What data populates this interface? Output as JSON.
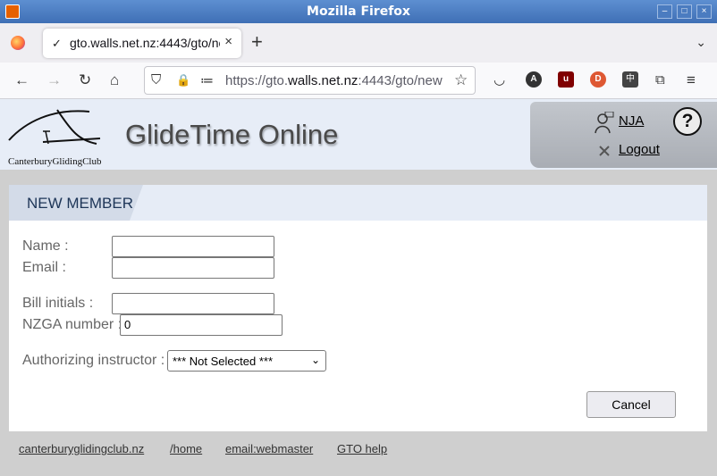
{
  "window": {
    "title": "Mozilla Firefox",
    "min_glyph": "–",
    "max_glyph": "□",
    "close_glyph": "×"
  },
  "tab": {
    "favicon_glyph": "✓",
    "label": "gto.walls.net.nz:4443/gto/new",
    "close_glyph": "×",
    "newtab_glyph": "+",
    "list_glyph": "⌄"
  },
  "nav": {
    "back_glyph": "←",
    "forward_glyph": "→",
    "reload_glyph": "↻",
    "home_glyph": "⌂",
    "url_prefix": "https://gto.",
    "url_host": "walls.net.nz",
    "url_rest": ":4443/gto/new",
    "bookmark_glyph": "☆",
    "shield_glyph": "⛉",
    "lock_glyph": "🔒",
    "perm_glyph": "≔",
    "pocket_glyph": "◡",
    "ext_a_label": "A",
    "ext_ublock_label": "u",
    "ext_ddg_label": "D",
    "ext_zh_label": "中",
    "ext_puzzle_glyph": "⧉",
    "menu_glyph": "≡"
  },
  "banner": {
    "logo_text": "CanterburyGlidingClub",
    "app_title": "GlideTime Online",
    "user_name": "NJA",
    "logout_label": "Logout",
    "help_label": "?"
  },
  "form": {
    "panel_title": "NEW MEMBER",
    "name_label": "Name :",
    "name_value": "",
    "email_label": "Email :",
    "email_value": "",
    "bill_label": "Bill initials :",
    "bill_value": "",
    "nzga_label": "NZGA number :",
    "nzga_value": "0",
    "instructor_label": "Authorizing instructor :",
    "instructor_selected": "*** Not Selected ***",
    "cancel_label": "Cancel"
  },
  "footer": {
    "link1": "canterburyglidingclub.nz",
    "link2": "/home",
    "link3": "email:webmaster",
    "link4": "GTO help"
  },
  "colors": {
    "titlebar": "#4a7ec4",
    "banner": "#e7edf7",
    "panel_head": "#e6ecf6",
    "page_bg": "#cfcfcf"
  }
}
